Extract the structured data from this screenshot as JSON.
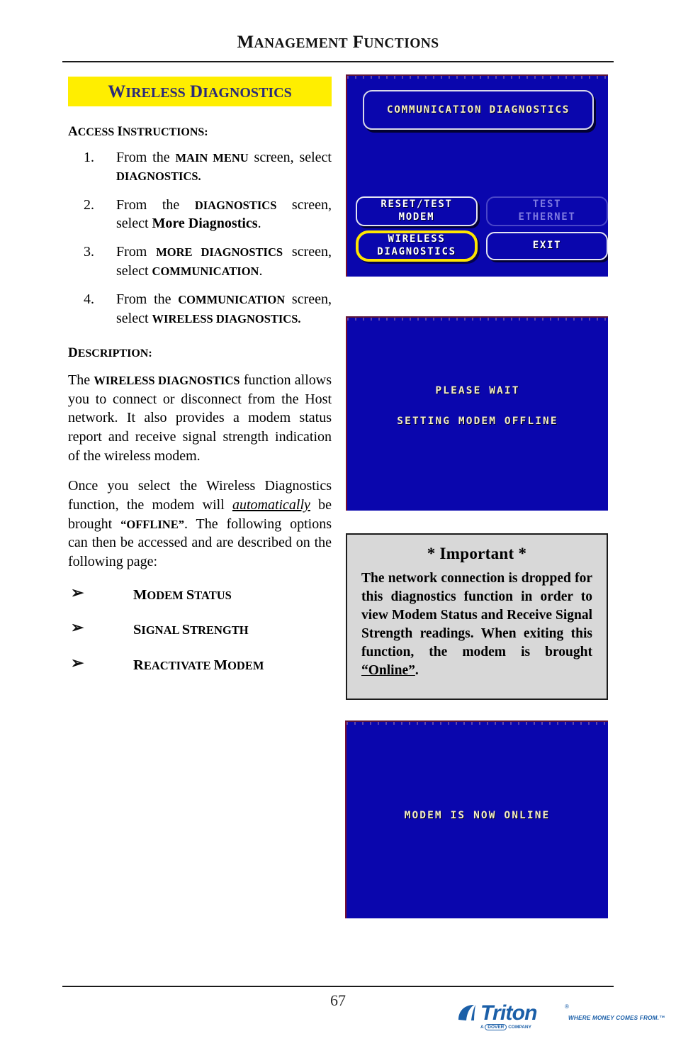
{
  "header": {
    "title_part1_cap": "M",
    "title_part1_rest": "ANAGEMENT",
    "title_part2_cap": "F",
    "title_part2_rest": "UNCTIONS"
  },
  "section": {
    "band_cap1": "W",
    "band_rest1": "IRELESS",
    "band_cap2": "D",
    "band_rest2": "IAGNOSTICS",
    "band_color": "#ffee00",
    "band_text_color": "#2a2a7a"
  },
  "access": {
    "heading_cap": "A",
    "heading_rest": "CCESS ",
    "heading_cap2": "I",
    "heading_rest2": "NSTRUCTIONS:",
    "steps": [
      {
        "seg1": "From the ",
        "sc1": "MAIN MENU",
        "seg2": " screen, select ",
        "sc2": "DIAGNOSTICS.",
        "seg3": ""
      },
      {
        "seg1": "From the ",
        "sc1": "DIAGNOSTICS",
        "seg2": " screen, select ",
        "sc2": "More Diagnostics",
        "seg3": "."
      },
      {
        "seg1": "From ",
        "sc1": "MORE DIAGNOSTICS",
        "seg2": " screen, select ",
        "sc2": "COMMUNICATION",
        "seg3": "."
      },
      {
        "seg1": "From the ",
        "sc1": "COMMUNICATION",
        "seg2": " screen, select ",
        "sc2": "WIRELESS DIAGNOSTICS.",
        "seg3": ""
      }
    ]
  },
  "description": {
    "heading_cap": "D",
    "heading_rest": "ESCRIPTION:",
    "para1_seg1": "The ",
    "para1_sc": "WIRELESS DIAGNOSTICS",
    "para1_seg2": " function allows you to connect or disconnect from the Host network.  It also provides a modem status report and receive signal strength indication of the wireless modem.",
    "para2_seg1": "Once you select the Wireless Diagnostics function, the modem will ",
    "para2_ital": "automatically",
    "para2_seg2": " be brought ",
    "para2_sc": "“OFFLINE”",
    "para2_seg3": ". The following options can then be accessed and are described on the following page:"
  },
  "options": {
    "arrow_glyph": "➢",
    "items": [
      {
        "cap": "M",
        "rest": "ODEM ",
        "cap2": "S",
        "rest2": "TATUS"
      },
      {
        "cap": "S",
        "rest": "IGNAL  ",
        "cap2": "S",
        "rest2": "TRENGTH"
      },
      {
        "cap": "R",
        "rest": "EACTIVATE ",
        "cap2": "M",
        "rest2": "ODEM"
      }
    ]
  },
  "screens": {
    "screen1": {
      "title": "COMMUNICATION DIAGNOSTICS",
      "buttons": [
        {
          "label_line1": "RESET/TEST",
          "label_line2": "MODEM",
          "state": "enabled"
        },
        {
          "label_line1": "TEST",
          "label_line2": "ETHERNET",
          "state": "disabled"
        },
        {
          "label_line1": "WIRELESS",
          "label_line2": "DIAGNOSTICS",
          "state": "highlighted"
        },
        {
          "label_line1": "EXIT",
          "label_line2": "",
          "state": "enabled"
        }
      ],
      "bg_color": "#0a06ad",
      "highlight_color": "#ffe500",
      "title_text_color": "#f5eec0"
    },
    "screen2": {
      "line1": "PLEASE WAIT",
      "line2": "SETTING MODEM OFFLINE",
      "bg_color": "#0a06ad"
    },
    "screen3": {
      "line1": "MODEM IS NOW ONLINE",
      "bg_color": "#0a06ad"
    }
  },
  "important": {
    "title": "* Important *",
    "body_seg1": "The network connection is dropped for this diagnostics function in order to view Modem Status and Receive Signal Strength readings. When exiting this function, the modem is brought ",
    "body_underlined": "“Online”",
    "body_seg2": ".",
    "bg_color": "#d8d8d8"
  },
  "footer": {
    "page_number": "67",
    "logo_word": "Triton",
    "logo_reg": "®",
    "logo_tagline": "WHERE MONEY COMES FROM.™",
    "logo_dover_prefix": "A ",
    "logo_dover_box": "DOVER",
    "logo_dover_suffix": " COMPANY",
    "logo_color": "#1b5fa8"
  }
}
